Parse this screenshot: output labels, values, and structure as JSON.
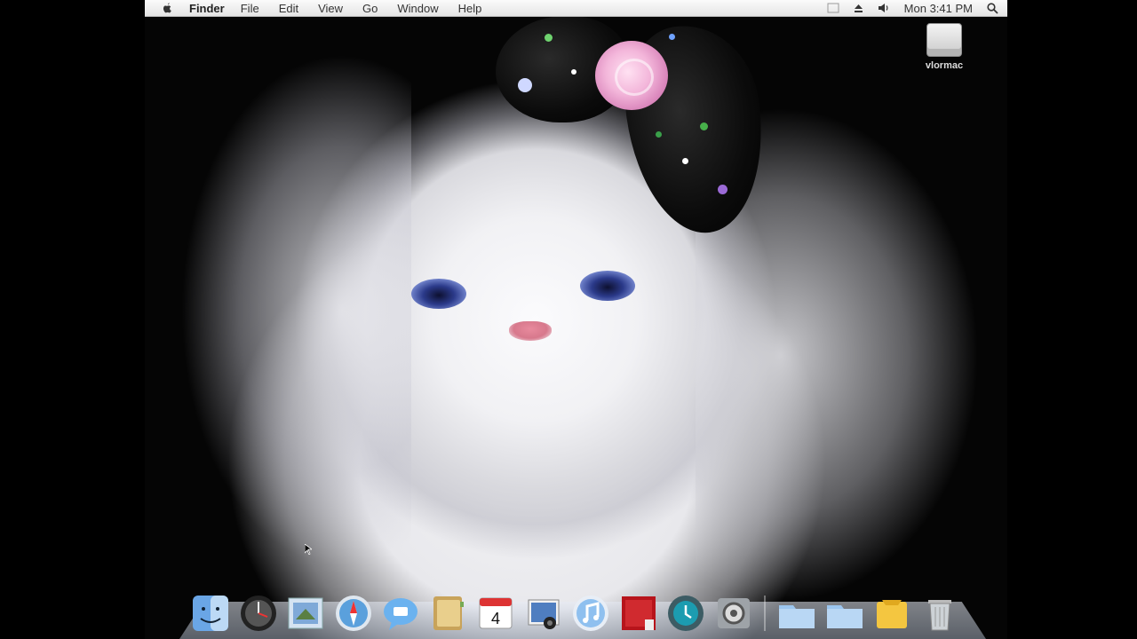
{
  "menubar": {
    "app_name": "Finder",
    "menus": [
      "File",
      "Edit",
      "View",
      "Go",
      "Window",
      "Help"
    ],
    "clock": "Mon 3:41 PM"
  },
  "desktop": {
    "hd_label": "vlormac"
  },
  "dock": {
    "items": [
      {
        "name": "finder-icon",
        "day": ""
      },
      {
        "name": "dashboard-icon",
        "day": ""
      },
      {
        "name": "mail-icon",
        "day": ""
      },
      {
        "name": "safari-icon",
        "day": ""
      },
      {
        "name": "ichat-icon",
        "day": ""
      },
      {
        "name": "address-book-icon",
        "day": ""
      },
      {
        "name": "ical-icon",
        "day": "4"
      },
      {
        "name": "iphoto-icon",
        "day": ""
      },
      {
        "name": "itunes-icon",
        "day": ""
      },
      {
        "name": "photo-booth-icon",
        "day": ""
      },
      {
        "name": "time-machine-icon",
        "day": ""
      },
      {
        "name": "system-preferences-icon",
        "day": ""
      }
    ],
    "stacks": [
      "applications-stack-icon",
      "documents-stack-icon",
      "downloads-stack-icon",
      "trash-icon"
    ]
  }
}
